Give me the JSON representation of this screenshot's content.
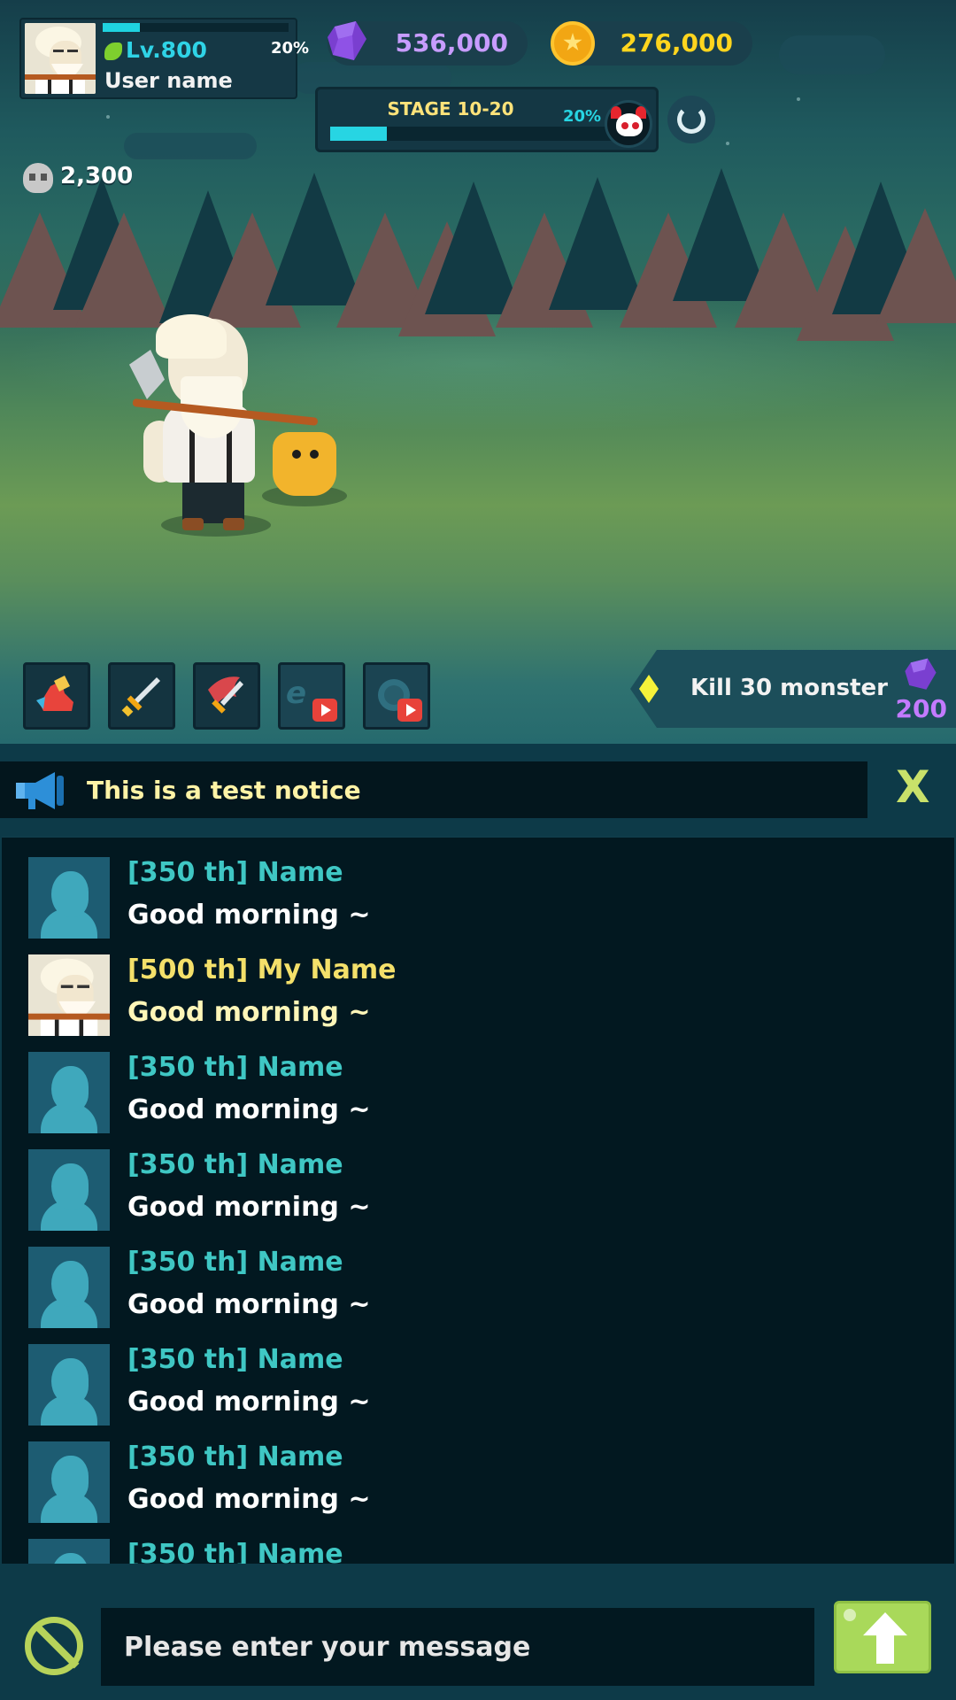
{
  "player": {
    "level": "Lv.800",
    "xp_percent": "20%",
    "xp_fraction": 0.2,
    "name": "User name"
  },
  "currency": {
    "gems": "536,000",
    "gold": "276,000"
  },
  "stage": {
    "label": "STAGE 10-20",
    "progress_percent": "20%",
    "progress_fraction": 0.2
  },
  "kills": "2,300",
  "skills": [
    {
      "name": "boot-skill"
    },
    {
      "name": "sword-skill"
    },
    {
      "name": "flame-sword-skill"
    },
    {
      "name": "exp-boost-ad"
    },
    {
      "name": "gold-boost-ad"
    }
  ],
  "quest": {
    "text": "Kill 30 monster",
    "reward": "200"
  },
  "notice": {
    "text": "This is a test notice",
    "close_label": "X"
  },
  "messages": [
    {
      "name": "[350 th] Name",
      "text": "Good morning ~",
      "mine": false
    },
    {
      "name": "[500 th] My Name",
      "text": "Good morning ~",
      "mine": true
    },
    {
      "name": "[350 th] Name",
      "text": "Good morning ~",
      "mine": false
    },
    {
      "name": "[350 th] Name",
      "text": "Good morning ~",
      "mine": false
    },
    {
      "name": "[350 th] Name",
      "text": "Good morning ~",
      "mine": false
    },
    {
      "name": "[350 th] Name",
      "text": "Good morning ~",
      "mine": false
    },
    {
      "name": "[350 th] Name",
      "text": "Good morning ~",
      "mine": false
    },
    {
      "name": "[350 th] Name",
      "text": "",
      "mine": false
    }
  ],
  "input": {
    "placeholder": "Please enter your message"
  },
  "colors": {
    "accent_cyan": "#27d5e3",
    "gem_purple": "#c79cff",
    "gold_yellow": "#ffd51e",
    "send_green": "#a9d95a"
  }
}
